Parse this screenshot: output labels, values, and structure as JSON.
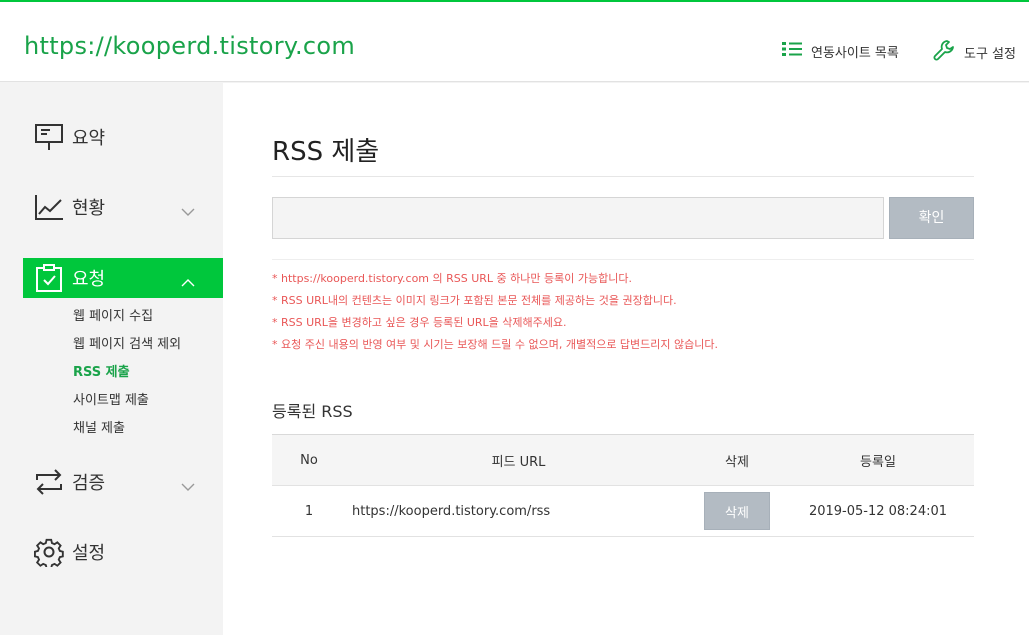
{
  "header": {
    "site_url": "https://kooperd.tistory.com",
    "linked_sites_label": "연동사이트 목록",
    "tools_label": "도구 설정"
  },
  "sidebar": {
    "items": [
      {
        "label": "요약"
      },
      {
        "label": "현황"
      },
      {
        "label": "요청"
      },
      {
        "label": "검증"
      },
      {
        "label": "설정"
      }
    ],
    "request_sub": [
      {
        "label": "웹 페이지 수집"
      },
      {
        "label": "웹 페이지 검색 제외"
      },
      {
        "label": "RSS 제출"
      },
      {
        "label": "사이트맵 제출"
      },
      {
        "label": "채널 제출"
      }
    ]
  },
  "main": {
    "title": "RSS 제출",
    "input_value": "",
    "confirm_label": "확인",
    "notices": [
      "* https://kooperd.tistory.com 의 RSS URL 중 하나만 등록이 가능합니다.",
      "* RSS URL내의 컨텐츠는 이미지 링크가 포함된 본문 전체를 제공하는 것을 권장합니다.",
      "* RSS URL을 변경하고 싶은 경우 등록된 URL을 삭제해주세요.",
      "* 요청 주신 내용의 반영 여부 및 시기는 보장해 드릴 수 없으며, 개별적으로 답변드리지 않습니다."
    ],
    "registered_title": "등록된 RSS",
    "table": {
      "headers": [
        "No",
        "피드 URL",
        "삭제",
        "등록일"
      ],
      "rows": [
        {
          "no": "1",
          "url": "https://kooperd.tistory.com/rss",
          "delete_label": "삭제",
          "date": "2019-05-12 08:24:01"
        }
      ]
    }
  },
  "colors": {
    "brand_green": "#00c73c",
    "title_green": "#1aa34a",
    "notice_red": "#e95757",
    "button_gray": "#b3bbc3"
  }
}
